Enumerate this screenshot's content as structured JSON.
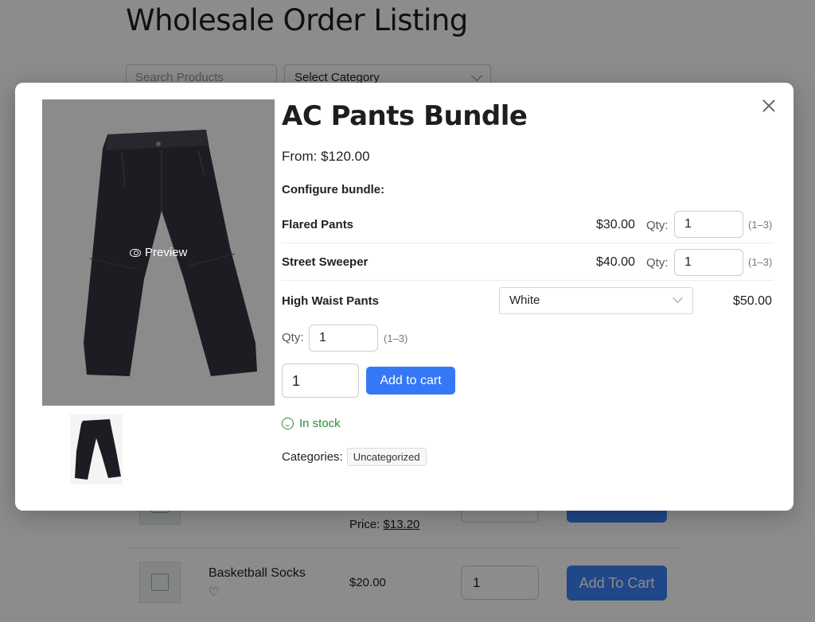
{
  "background_page": {
    "title": "Wholesale Order Listing",
    "search_placeholder": "Search Products",
    "category_select": "Select Category",
    "rows": [
      {
        "name": "",
        "price_prefix": "Price: ",
        "price": "$13.20",
        "qty": "",
        "button": "Add To Cart"
      },
      {
        "name": "Basketball Socks",
        "price": "$20.00",
        "qty": "1",
        "button": "Add To Cart"
      }
    ]
  },
  "modal": {
    "title": "AC Pants Bundle",
    "price_text": "From: $120.00",
    "configure_label": "Configure bundle:",
    "preview_label": "Preview",
    "qty_label": "Qty:",
    "items": [
      {
        "name": "Flared Pants",
        "price": "$30.00",
        "qty": "1",
        "range": "(1–3)"
      },
      {
        "name": "Street Sweeper",
        "price": "$40.00",
        "qty": "1",
        "range": "(1–3)"
      },
      {
        "name": "High Waist Pants",
        "variant": "White",
        "price": "$50.00",
        "qty": "1",
        "range": "(1–3)"
      }
    ],
    "main_qty": "1",
    "add_to_cart": "Add to cart",
    "stock_status": "In stock",
    "categories_label": "Categories:",
    "category_tag": "Uncategorized"
  },
  "colors": {
    "accent": "#3478f6",
    "in_stock": "#2e8b3a",
    "overlay": "rgba(0,0,0,0.45)"
  },
  "icons": [
    "close-icon",
    "eye-icon",
    "chevron-down-icon",
    "smile-icon",
    "heart-icon"
  ]
}
